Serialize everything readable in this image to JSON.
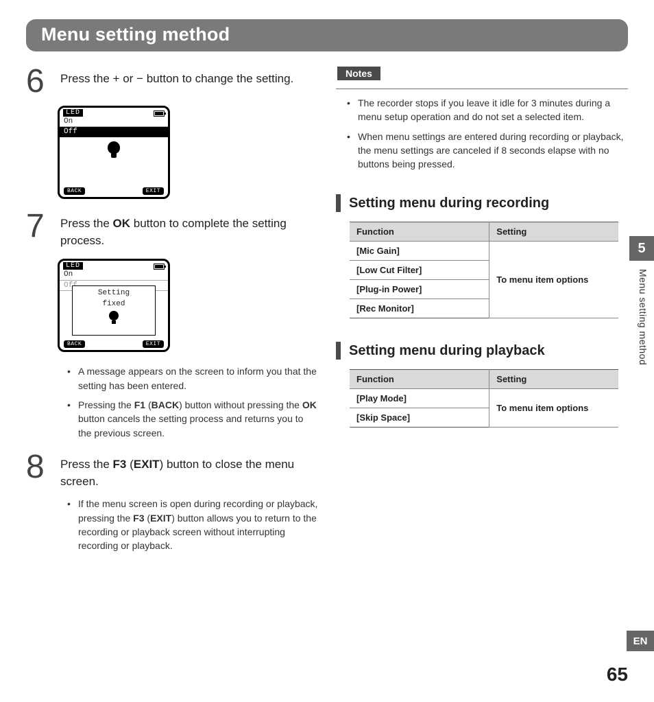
{
  "page": {
    "title": "Menu setting method",
    "chapter": "5",
    "side_label": "Menu setting method",
    "lang": "EN",
    "number": "65"
  },
  "left": {
    "step6": {
      "num": "6",
      "text_before": "Press the ",
      "plus": "+",
      "mid": " or ",
      "minus": "−",
      "text_after": " button to change the setting."
    },
    "screen1": {
      "title": "LED",
      "line_on": "On",
      "line_off": "Off",
      "back": "BACK",
      "exit": "EXIT"
    },
    "step7": {
      "num": "7",
      "pre": "Press the ",
      "ok": "OK",
      "post": " button to complete the setting process."
    },
    "screen2": {
      "title": "LED",
      "line_on": "On",
      "line_off": "Off",
      "popup_l1": "Setting",
      "popup_l2": "fixed",
      "back": "BACK",
      "exit": "EXIT"
    },
    "bullets7": {
      "b1": "A message appears on the screen to inform you that the setting has been entered.",
      "b2_pre": "Pressing the ",
      "b2_f1": "F1",
      "b2_paren_open": " (",
      "b2_back": "BACK",
      "b2_paren_close": ") button without pressing the ",
      "b2_ok": "OK",
      "b2_post": " button cancels the setting process and returns you to the previous screen."
    },
    "step8": {
      "num": "8",
      "pre": "Press the ",
      "f3": "F3",
      "paren_open": " (",
      "exit": "EXIT",
      "paren_close": ") button to close the menu screen."
    },
    "bullets8": {
      "b1_pre": "If the menu screen is open during recording or playback, pressing the ",
      "b1_f3": "F3",
      "b1_paren_open": " (",
      "b1_exit": "EXIT",
      "b1_paren_close": ") button allows you to return to the recording or playback screen without interrupting recording or playback."
    }
  },
  "right": {
    "notes_label": "Notes",
    "notes": {
      "n1": "The recorder stops if you leave it idle for 3 minutes during a menu setup operation and do not set a selected item.",
      "n2": "When menu settings are entered during recording or playback, the menu settings are canceled if 8 seconds elapse with no buttons being pressed."
    },
    "sec1": {
      "title": "Setting menu during recording",
      "th_func": "Function",
      "th_set": "Setting",
      "rows": [
        "[Mic Gain]",
        "[Low Cut Filter]",
        "[Plug-in Power]",
        "[Rec Monitor]"
      ],
      "setting": "To menu item options"
    },
    "sec2": {
      "title": "Setting menu during playback",
      "th_func": "Function",
      "th_set": "Setting",
      "rows": [
        "[Play Mode]",
        "[Skip Space]"
      ],
      "setting": "To menu item options"
    }
  }
}
